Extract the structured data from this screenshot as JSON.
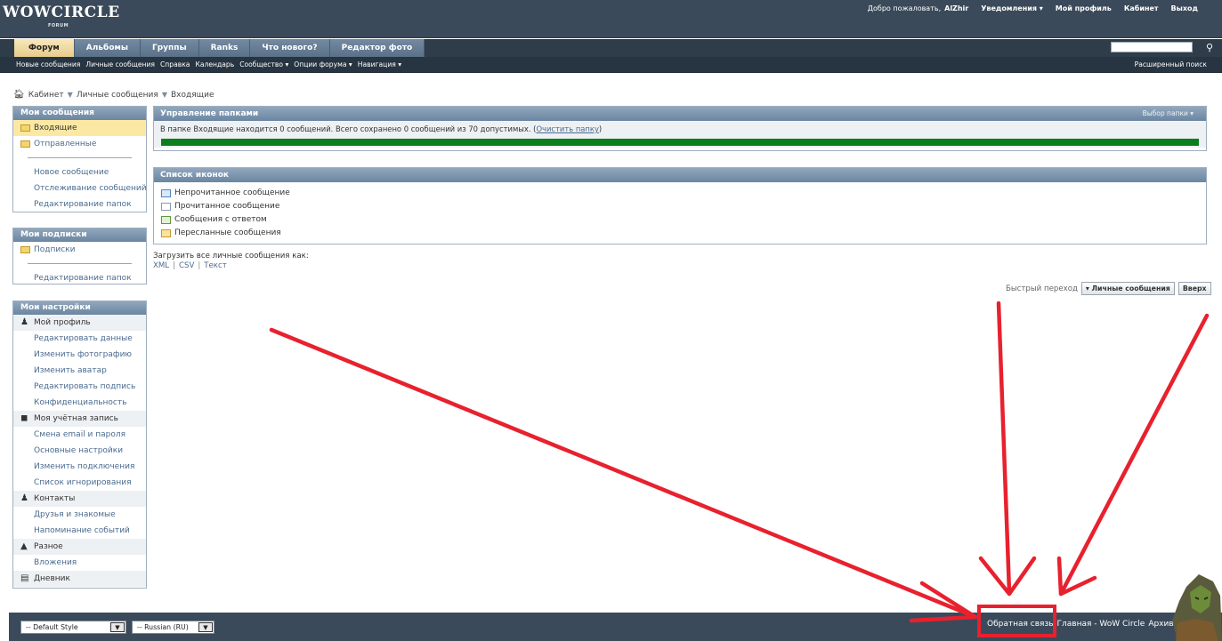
{
  "header": {
    "logo_text": "WOWCIRCLE",
    "logo_sub": "FORUM",
    "welcome": "Добро пожаловать,",
    "username": "AlZhir",
    "notifications": "Уведомления ▾",
    "my_profile": "Мой профиль",
    "cabinet": "Кабинет",
    "logout": "Выход"
  },
  "nav": {
    "tabs": [
      "Форум",
      "Альбомы",
      "Группы",
      "Ranks",
      "Что нового?",
      "Редактор фото"
    ],
    "search_placeholder": "",
    "search_icon": "magnifier-icon"
  },
  "subnav": {
    "items": [
      "Новые сообщения",
      "Личные сообщения",
      "Справка",
      "Календарь",
      "Сообщество ▾",
      "Опции форума ▾",
      "Навигация ▾"
    ],
    "advanced_search": "Расширенный поиск"
  },
  "breadcrumb": {
    "home_icon": "home-icon",
    "items": [
      "Кабинет",
      "Личные сообщения",
      "Входящие"
    ]
  },
  "sidebar": {
    "messages": {
      "title": "Мои сообщения",
      "folders": [
        "Входящие",
        "Отправленные"
      ],
      "links": [
        "Новое сообщение",
        "Отслеживание сообщений",
        "Редактирование папок"
      ]
    },
    "subscriptions": {
      "title": "Мои подписки",
      "folders": [
        "Подписки"
      ],
      "links": [
        "Редактирование папок"
      ]
    },
    "settings": {
      "title": "Мои настройки",
      "profile_section": "Мой профиль",
      "profile_links": [
        "Редактировать данные",
        "Изменить фотографию",
        "Изменить аватар",
        "Редактировать подпись",
        "Конфиденциальность"
      ],
      "account_section": "Моя учётная запись",
      "account_links": [
        "Смена email и пароля",
        "Основные настройки",
        "Изменить подключения",
        "Список игнорирования"
      ],
      "contacts_section": "Контакты",
      "contacts_links": [
        "Друзья и знакомые",
        "Напоминание событий"
      ],
      "misc_section": "Разное",
      "misc_links": [
        "Вложения"
      ],
      "diary_section": "Дневник"
    }
  },
  "folder_control": {
    "title": "Управление папками",
    "select_label": "Выбор папки ▾",
    "info": "В папке Входящие находится 0 сообщений. Всего сохранено 0 сообщений из 70 допустимых.",
    "clear_link": "Очистить папку",
    "usage_fraction": 1.0,
    "usage_color": "#0b7f1b"
  },
  "icon_list": {
    "title": "Список иконок",
    "items": [
      "Непрочитанное сообщение",
      "Прочитанное сообщение",
      "Сообщения с ответом",
      "Пересланные сообщения"
    ]
  },
  "download": {
    "label": "Загрузить все личные сообщения как:",
    "formats": [
      "XML",
      "CSV",
      "Текст"
    ]
  },
  "quick_nav": {
    "label": "Быстрый переход",
    "current": "▾ Личные сообщения",
    "top": "Вверх"
  },
  "footer": {
    "style_select": "-- Default Style",
    "lang_select": "-- Russian (RU)",
    "links": [
      "Обратная связь",
      "Главная - WoW Circle",
      "Архив"
    ]
  },
  "colors": {
    "header_bg": "#3b4a5a",
    "active_tab": "#f0dba4",
    "annotation_red": "#e8212e"
  }
}
